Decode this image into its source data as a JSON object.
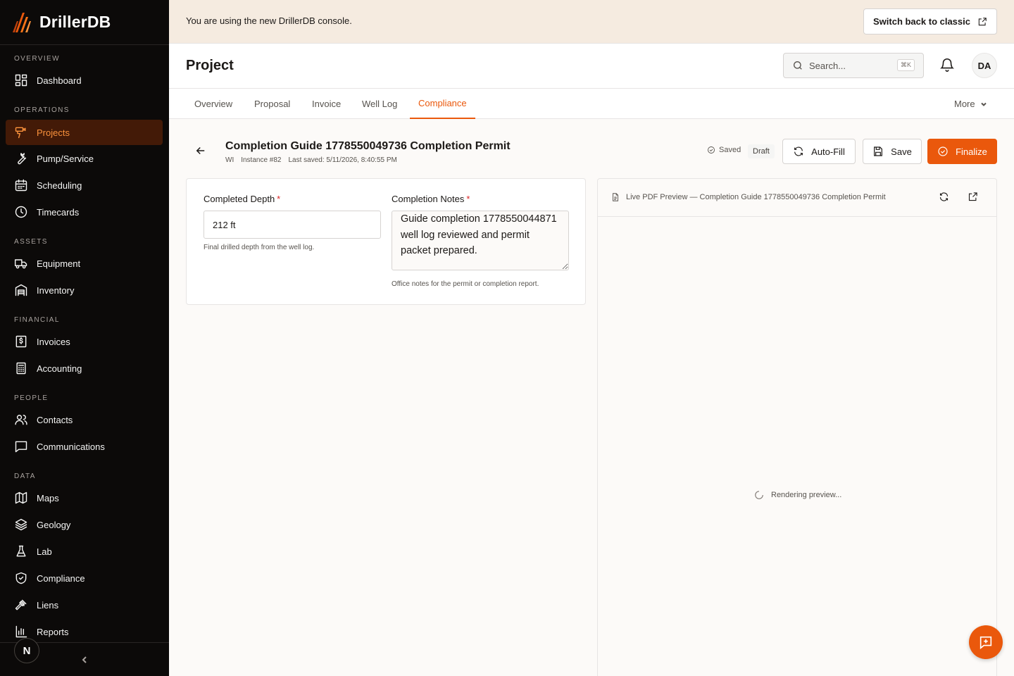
{
  "brand": {
    "name": "DrillerDB",
    "accent": "#ea580c"
  },
  "sidebar": {
    "sections": [
      {
        "title": "OVERVIEW",
        "items": [
          {
            "label": "Dashboard",
            "icon": "dashboard-icon"
          }
        ]
      },
      {
        "title": "OPERATIONS",
        "items": [
          {
            "label": "Projects",
            "icon": "drill-icon",
            "active": true
          },
          {
            "label": "Pump/Service",
            "icon": "wrench-icon"
          },
          {
            "label": "Scheduling",
            "icon": "calendar-icon"
          },
          {
            "label": "Timecards",
            "icon": "clock-icon"
          }
        ]
      },
      {
        "title": "ASSETS",
        "items": [
          {
            "label": "Equipment",
            "icon": "truck-icon"
          },
          {
            "label": "Inventory",
            "icon": "warehouse-icon"
          }
        ]
      },
      {
        "title": "FINANCIAL",
        "items": [
          {
            "label": "Invoices",
            "icon": "invoice-icon"
          },
          {
            "label": "Accounting",
            "icon": "calculator-icon"
          }
        ]
      },
      {
        "title": "PEOPLE",
        "items": [
          {
            "label": "Contacts",
            "icon": "users-icon"
          },
          {
            "label": "Communications",
            "icon": "message-icon"
          }
        ]
      },
      {
        "title": "DATA",
        "items": [
          {
            "label": "Maps",
            "icon": "map-icon"
          },
          {
            "label": "Geology",
            "icon": "layers-icon"
          },
          {
            "label": "Lab",
            "icon": "flask-icon"
          },
          {
            "label": "Compliance",
            "icon": "shield-icon"
          },
          {
            "label": "Liens",
            "icon": "gavel-icon"
          },
          {
            "label": "Reports",
            "icon": "chart-icon"
          }
        ]
      }
    ],
    "footer_avatar": "N"
  },
  "banner": {
    "text": "You are using the new DrillerDB console.",
    "button": "Switch back to classic"
  },
  "header": {
    "title": "Project",
    "search_placeholder": "Search...",
    "search_shortcut": "⌘K",
    "user_initials": "DA"
  },
  "tabs": {
    "items": [
      "Overview",
      "Proposal",
      "Invoice",
      "Well Log",
      "Compliance"
    ],
    "active": "Compliance",
    "more": "More"
  },
  "document": {
    "title": "Completion Guide 1778550049736 Completion Permit",
    "state": "WI",
    "instance": "Instance #82",
    "last_saved": "Last saved: 5/11/2026, 8:40:55 PM",
    "saved_label": "Saved",
    "status": "Draft",
    "autofill_label": "Auto-Fill",
    "save_label": "Save",
    "finalize_label": "Finalize"
  },
  "form": {
    "depth_label": "Completed Depth",
    "depth_value": "212 ft",
    "depth_help": "Final drilled depth from the well log.",
    "notes_label": "Completion Notes",
    "notes_value": "Guide completion 1778550044871 well log reviewed and permit packet prepared.",
    "notes_help": "Office notes for the permit or completion report."
  },
  "preview": {
    "title": "Live PDF Preview — Completion Guide 1778550049736 Completion Permit",
    "status": "Rendering preview..."
  }
}
